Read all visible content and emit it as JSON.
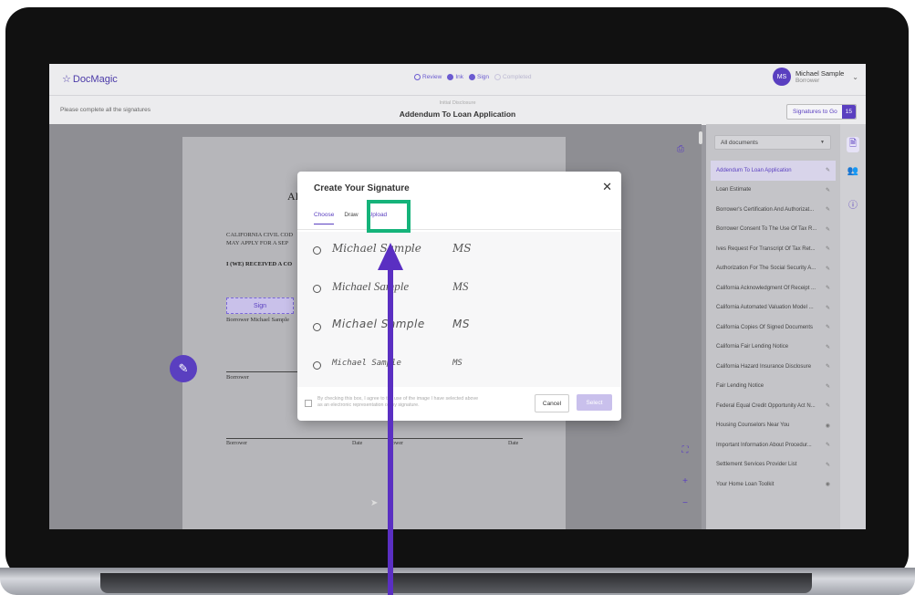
{
  "app": {
    "logo": "DocMagic",
    "steps": [
      {
        "label": "Review",
        "state": "done"
      },
      {
        "label": "Ink",
        "state": "active"
      },
      {
        "label": "Sign",
        "state": "active"
      },
      {
        "label": "Completed",
        "state": "pending"
      }
    ],
    "user": {
      "initials": "MS",
      "name": "Michael Sample",
      "role": "Borrower"
    }
  },
  "subbar": {
    "hint": "Please complete all the signatures",
    "doc_type": "Initial Disclosure",
    "doc_title": "Addendum To Loan Application",
    "signatures_label": "Signatures to Go",
    "signatures_count": "15"
  },
  "document": {
    "title_fragment": "AD",
    "line1": "CALIFORNIA CIVIL COD",
    "line2": "MAY APPLY FOR A SEP",
    "line3": "I (WE) RECEIVED A CO",
    "sign_label": "Sign",
    "borrower_name_line": "Borrower Michael Sample",
    "borrower_label": "Borrower",
    "footer_borrower1": "Borrower",
    "footer_date1": "Date",
    "footer_borrower2": "rrower",
    "footer_date2": "Date"
  },
  "panel": {
    "filter_value": "All documents",
    "documents": [
      {
        "label": "Addendum To Loan Application",
        "icon": "pencil-icon",
        "active": true
      },
      {
        "label": "Loan Estimate",
        "icon": "pencil-icon"
      },
      {
        "label": "Borrower's Certification And Authorizat...",
        "icon": "pencil-icon"
      },
      {
        "label": "Borrower Consent To The Use Of Tax R...",
        "icon": "pencil-icon"
      },
      {
        "label": "Ives Request For Transcript Of Tax Ret...",
        "icon": "pencil-icon"
      },
      {
        "label": "Authorization For The Social Security A...",
        "icon": "pencil-icon"
      },
      {
        "label": "California Acknowledgment Of Receipt ...",
        "icon": "pencil-icon"
      },
      {
        "label": "California Automated Valuation Model ...",
        "icon": "pencil-icon"
      },
      {
        "label": "California Copies Of Signed Documents",
        "icon": "pencil-icon"
      },
      {
        "label": "California Fair Lending Notice",
        "icon": "pencil-icon"
      },
      {
        "label": "California Hazard Insurance Disclosure",
        "icon": "pencil-icon"
      },
      {
        "label": "Fair Lending Notice",
        "icon": "pencil-icon"
      },
      {
        "label": "Federal Equal Credit Opportunity Act N...",
        "icon": "pencil-icon"
      },
      {
        "label": "Housing Counselors Near You",
        "icon": "eye-icon"
      },
      {
        "label": "Important Information About Procedur...",
        "icon": "pencil-icon"
      },
      {
        "label": "Settlement Services Provider List",
        "icon": "pencil-icon"
      },
      {
        "label": "Your Home Loan Toolkit",
        "icon": "eye-icon"
      }
    ]
  },
  "modal": {
    "title": "Create Your Signature",
    "tabs": [
      "Choose",
      "Draw",
      "Upload"
    ],
    "signatures": [
      {
        "full": "Michael Sample",
        "initials": "MS"
      },
      {
        "full": "Michael Sample",
        "initials": "MS"
      },
      {
        "full": "Michael Sample",
        "initials": "MS"
      },
      {
        "full": "Michael Sample",
        "initials": "MS"
      }
    ],
    "consent": "By checking this box, I agree to the use of the image I have selected above as an electronic representation of my signature.",
    "cancel": "Cancel",
    "select": "Select"
  },
  "colors": {
    "brand": "#5a3fc0",
    "highlight": "#15b37a",
    "arrow": "#5a2fc2"
  }
}
